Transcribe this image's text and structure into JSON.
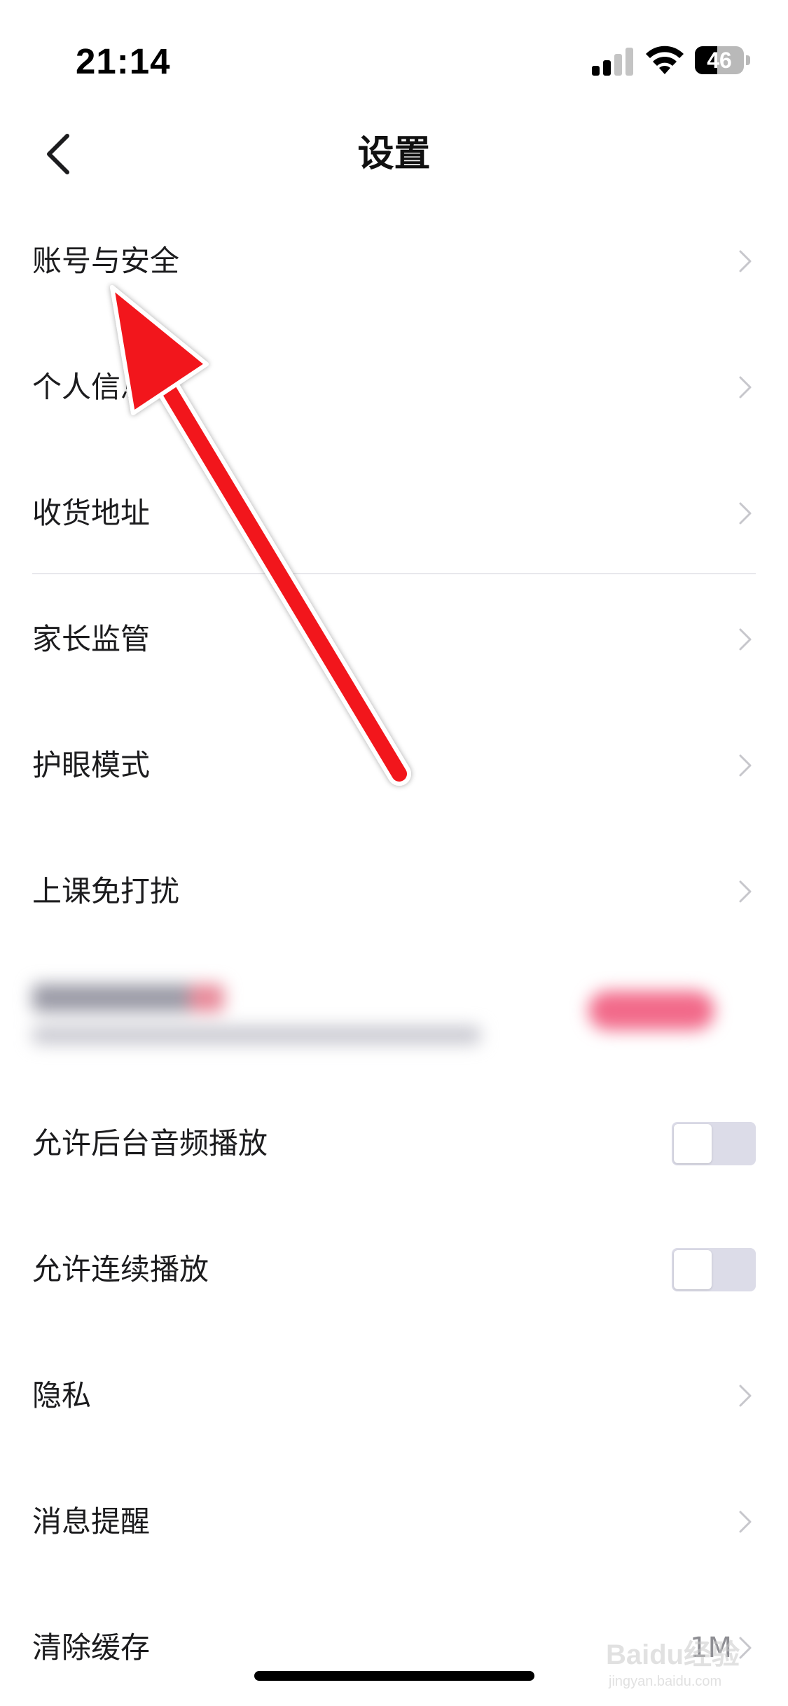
{
  "status_bar": {
    "time": "21:14",
    "battery": "46",
    "battery_level_percent": 46,
    "signal_bars_active": 2,
    "signal_bars_total": 4
  },
  "header": {
    "title": "设置",
    "back_icon": "chevron-left-icon"
  },
  "settings": {
    "items": [
      {
        "label": "账号与安全",
        "type": "link"
      },
      {
        "label": "个人信息",
        "type": "link"
      },
      {
        "label": "收货地址",
        "type": "link"
      },
      {
        "label": "家长监管",
        "type": "link"
      },
      {
        "label": "护眼模式",
        "type": "link"
      },
      {
        "label": "上课免打扰",
        "type": "link"
      },
      {
        "label": "允许后台音频播放",
        "type": "toggle",
        "on": false
      },
      {
        "label": "允许连续播放",
        "type": "toggle",
        "on": false
      },
      {
        "label": "隐私",
        "type": "link"
      },
      {
        "label": "消息提醒",
        "type": "link"
      },
      {
        "label": "清除缓存",
        "type": "link",
        "value": "1M"
      }
    ]
  },
  "watermark": {
    "text": "Baidu经验",
    "sub": "jingyan.baidu.com"
  },
  "colors": {
    "annotation_arrow": "#f2141b",
    "toggle_off_track": "#dcdce8",
    "chevron": "#c7c7cc",
    "divider": "#e8e8ec"
  }
}
